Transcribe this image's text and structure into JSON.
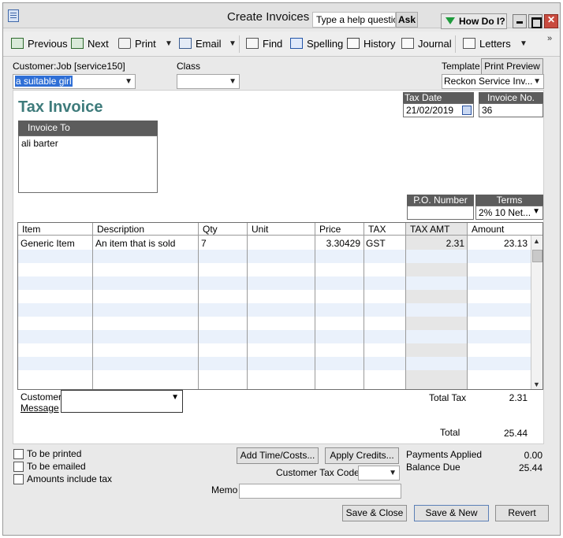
{
  "window": {
    "title": "Create Invoices",
    "help_placeholder": "Type a help question",
    "ask_label": "Ask",
    "how_do_i_label": "How Do I?"
  },
  "toolbar": {
    "previous": "Previous",
    "next": "Next",
    "print": "Print",
    "email": "Email",
    "find": "Find",
    "spelling": "Spelling",
    "history": "History",
    "journal": "Journal",
    "letters": "Letters",
    "more": "»"
  },
  "header": {
    "customer_job_label": "Customer:Job",
    "customer_job_code": "[service150]",
    "customer_job_value": "a suitable girl",
    "class_label": "Class",
    "class_value": "",
    "template_label": "Template",
    "print_preview_label": "Print Preview",
    "template_value": "Reckon Service Inv..."
  },
  "invoice": {
    "form_title": "Tax Invoice",
    "tax_date_label": "Tax Date",
    "tax_date_value": "21/02/2019",
    "invoice_no_label": "Invoice No.",
    "invoice_no_value": "36",
    "invoice_to_label": "Invoice To",
    "invoice_to_value": "ali barter",
    "po_number_label": "P.O. Number",
    "po_number_value": "",
    "terms_label": "Terms",
    "terms_value": "2% 10 Net..."
  },
  "table": {
    "columns": [
      "Item",
      "Description",
      "Qty",
      "Unit",
      "Price",
      "TAX",
      "TAX AMT",
      "Amount"
    ],
    "rows": [
      {
        "item": "Generic Item",
        "description": "An item that is sold",
        "qty": "7",
        "unit": "",
        "price": "3.30429",
        "tax": "GST",
        "tax_amt": "2.31",
        "amount": "23.13"
      }
    ]
  },
  "totals": {
    "customer_message_label_1": "Customer",
    "customer_message_label_2": "Message",
    "total_tax_label": "Total Tax",
    "total_tax_value": "2.31",
    "total_label": "Total",
    "total_value": "25.44",
    "payments_applied_label": "Payments Applied",
    "payments_applied_value": "0.00",
    "balance_due_label": "Balance Due",
    "balance_due_value": "25.44"
  },
  "footer": {
    "to_be_printed": "To be printed",
    "to_be_emailed": "To be emailed",
    "amounts_include_tax": "Amounts include tax",
    "add_time_costs": "Add Time/Costs...",
    "apply_credits": "Apply Credits...",
    "customer_tax_code_label": "Customer Tax Code",
    "customer_tax_code_value": "",
    "memo_label": "Memo",
    "memo_value": "",
    "save_close": "Save & Close",
    "save_new": "Save & New",
    "revert": "Revert"
  }
}
